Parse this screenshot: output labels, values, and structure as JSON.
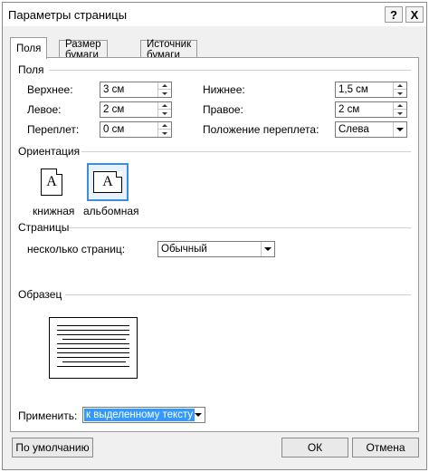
{
  "window": {
    "title": "Параметры страницы",
    "help": "?",
    "close": "X"
  },
  "tabs": [
    "Поля",
    "Размер бумаги",
    "Источник бумаги"
  ],
  "margins": {
    "group": "Поля",
    "top_label": "Верхнее:",
    "top_value": "3 см",
    "left_label": "Левое:",
    "left_value": "2 см",
    "gutter_label": "Переплет:",
    "gutter_value": "0 см",
    "bottom_label": "Нижнее:",
    "bottom_value": "1,5 см",
    "right_label": "Правое:",
    "right_value": "2 см",
    "gutter_pos_label": "Положение переплета:",
    "gutter_pos_value": "Слева"
  },
  "orientation": {
    "group": "Ориентация",
    "portrait_label": "книжная",
    "landscape_label": "альбомная",
    "icon_letter": "A",
    "selected": "landscape"
  },
  "pages": {
    "group": "Страницы",
    "multiple_label": "несколько страниц:",
    "multiple_value": "Обычный"
  },
  "preview": {
    "group": "Образец"
  },
  "apply": {
    "label": "Применить:",
    "value": "к выделенному тексту"
  },
  "buttons": {
    "default": "По умолчанию",
    "ok": "ОК",
    "cancel": "Отмена"
  }
}
